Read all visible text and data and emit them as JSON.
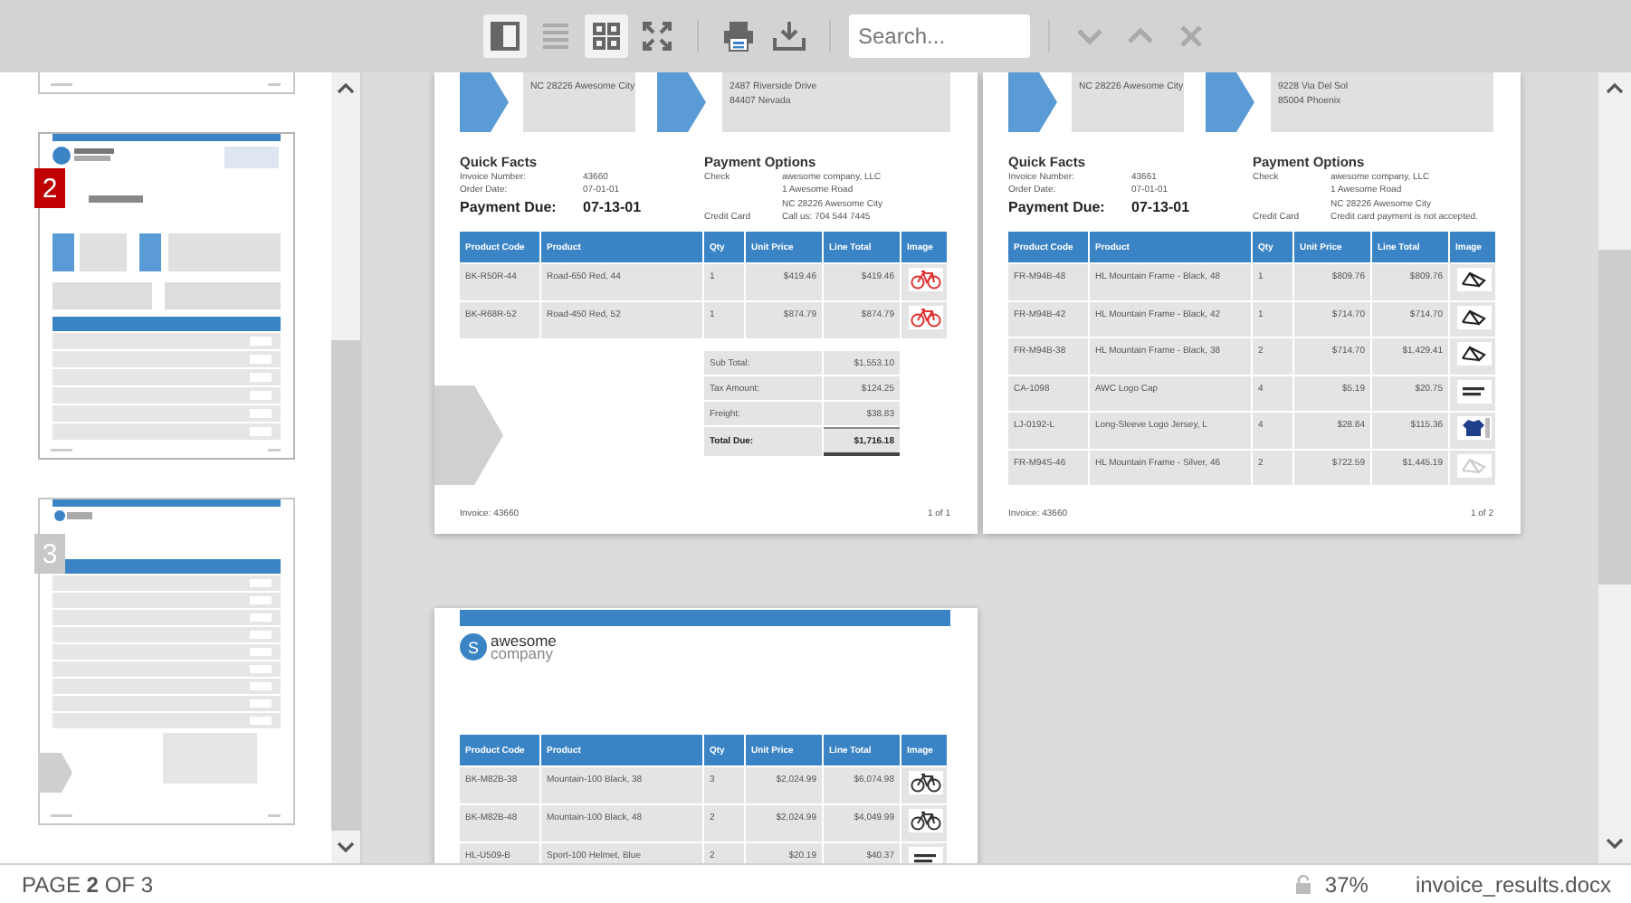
{
  "toolbar": {
    "view_buttons": [
      {
        "kind": "single",
        "selected": true,
        "disabled": false
      },
      {
        "kind": "continuous",
        "selected": false,
        "disabled": true
      },
      {
        "kind": "multi",
        "selected": true,
        "disabled": false
      },
      {
        "kind": "fullscreen",
        "selected": false,
        "disabled": false
      }
    ],
    "actions": [
      {
        "kind": "print"
      },
      {
        "kind": "download"
      }
    ],
    "search": {
      "placeholder": "Search..."
    },
    "navigation": [
      {
        "kind": "next",
        "disabled": true
      },
      {
        "kind": "previous",
        "disabled": true
      },
      {
        "kind": "close",
        "disabled": true
      }
    ]
  },
  "sidebar": {
    "thumbnails": [
      {
        "kind": "tail",
        "selected": false
      },
      {
        "kind": "invoice",
        "badge": "2",
        "selected": true
      },
      {
        "kind": "continuation",
        "badge": "3",
        "selected": false
      }
    ]
  },
  "pages": [
    {
      "addresses": {
        "company_lines": [
          "NC 28226 Awesome City"
        ],
        "customer_lines": [
          "2487 Riverside Drive",
          "84407 Nevada"
        ]
      },
      "quick_facts": {
        "title": "Quick Facts",
        "rows": [
          [
            "Invoice Number:",
            "43660"
          ],
          [
            "Order Date:",
            "07-01-01"
          ]
        ],
        "due": [
          "Payment Due:",
          "07-13-01"
        ]
      },
      "payment_options": {
        "title": "Payment Options",
        "rows": [
          [
            "Check",
            "awesome company, LLC"
          ],
          [
            "",
            "1 Awesome Road"
          ],
          [
            "",
            "NC 28226 Awesome City"
          ],
          [
            "Credit Card",
            "Call us: 704 544 7445"
          ]
        ]
      },
      "table": {
        "columns": [
          "Product Code",
          "Product",
          "Qty",
          "Unit Price",
          "Line Total",
          "Image"
        ],
        "rows": [
          {
            "cells": [
              "BK-R50R-44",
              "Road-650 Red, 44",
              "1",
              "$419.46",
              "$419.46"
            ],
            "kind": "redbike"
          },
          {
            "cells": [
              "BK-R68R-52",
              "Road-450 Red, 52",
              "1",
              "$874.79",
              "$874.79"
            ],
            "kind": "redbike"
          }
        ]
      },
      "totals": [
        {
          "kind": "plain",
          "label": "Sub Total:",
          "value": "$1,553.10"
        },
        {
          "kind": "plain",
          "label": "Tax Amount:",
          "value": "$124.25"
        },
        {
          "kind": "plain",
          "label": "Freight:",
          "value": "$38.83"
        },
        {
          "kind": "total",
          "label": "Total Due:",
          "value": "$1,716.18"
        }
      ],
      "footer": {
        "left": "Invoice: 43660",
        "right": "1 of 1"
      }
    },
    {
      "addresses": {
        "company_lines": [
          "NC 28226 Awesome City"
        ],
        "customer_lines": [
          "9228 Via Del Sol",
          "85004 Phoenix"
        ]
      },
      "quick_facts": {
        "title": "Quick Facts",
        "rows": [
          [
            "Invoice Number:",
            "43661"
          ],
          [
            "Order Date:",
            "07-01-01"
          ]
        ],
        "due": [
          "Payment Due:",
          "07-13-01"
        ]
      },
      "payment_options": {
        "title": "Payment Options",
        "rows": [
          [
            "Check",
            "awesome company, LLC"
          ],
          [
            "",
            "1 Awesome Road"
          ],
          [
            "",
            "NC 28226 Awesome City"
          ],
          [
            "Credit Card",
            "Credit card payment is not accepted."
          ]
        ]
      },
      "table": {
        "columns": [
          "Product Code",
          "Product",
          "Qty",
          "Unit Price",
          "Line Total",
          "Image"
        ],
        "rows": [
          {
            "cells": [
              "FR-M94B-48",
              "HL Mountain Frame - Black, 48",
              "1",
              "$809.76",
              "$809.76"
            ],
            "kind": "frame"
          },
          {
            "cells": [
              "FR-M94B-42",
              "HL Mountain Frame - Black, 42",
              "1",
              "$714.70",
              "$714.70"
            ],
            "kind": "frame"
          },
          {
            "cells": [
              "FR-M94B-38",
              "HL Mountain Frame - Black, 38",
              "2",
              "$714.70",
              "$1,429.41"
            ],
            "kind": "frame"
          },
          {
            "cells": [
              "CA-1098",
              "AWC Logo Cap",
              "4",
              "$5.19",
              "$20.75"
            ],
            "kind": "noimage"
          },
          {
            "cells": [
              "LJ-0192-L",
              "Long-Sleeve Logo Jersey, L",
              "4",
              "$28.84",
              "$115.36"
            ],
            "kind": "jersey"
          },
          {
            "cells": [
              "FR-M94S-46",
              "HL Mountain Frame - Silver, 46",
              "2",
              "$722.59",
              "$1,445.19"
            ],
            "kind": "paleframe"
          }
        ]
      },
      "footer": {
        "left": "Invoice: 43660",
        "right": "1 of 2"
      }
    },
    {
      "logo": {
        "mark": "S",
        "line1": "awesome",
        "line2": "company"
      },
      "table": {
        "columns": [
          "Product Code",
          "Product",
          "Qty",
          "Unit Price",
          "Line Total",
          "Image"
        ],
        "rows": [
          {
            "cells": [
              "BK-M82B-38",
              "Mountain-100 Black, 38",
              "3",
              "$2,024.99",
              "$6,074.98"
            ],
            "kind": "bike"
          },
          {
            "cells": [
              "BK-M82B-48",
              "Mountain-100 Black, 48",
              "2",
              "$2,024.99",
              "$4,049.99"
            ],
            "kind": "bike"
          },
          {
            "cells": [
              "HL-U509-B",
              "Sport-100 Helmet, Blue",
              "2",
              "$20.19",
              "$40.37"
            ],
            "kind": "noimage"
          }
        ]
      }
    }
  ],
  "status_bar": {
    "page_text": "PAGE **2** OF 3",
    "zoom": "37%",
    "file_name": "invoice_results.docx"
  }
}
